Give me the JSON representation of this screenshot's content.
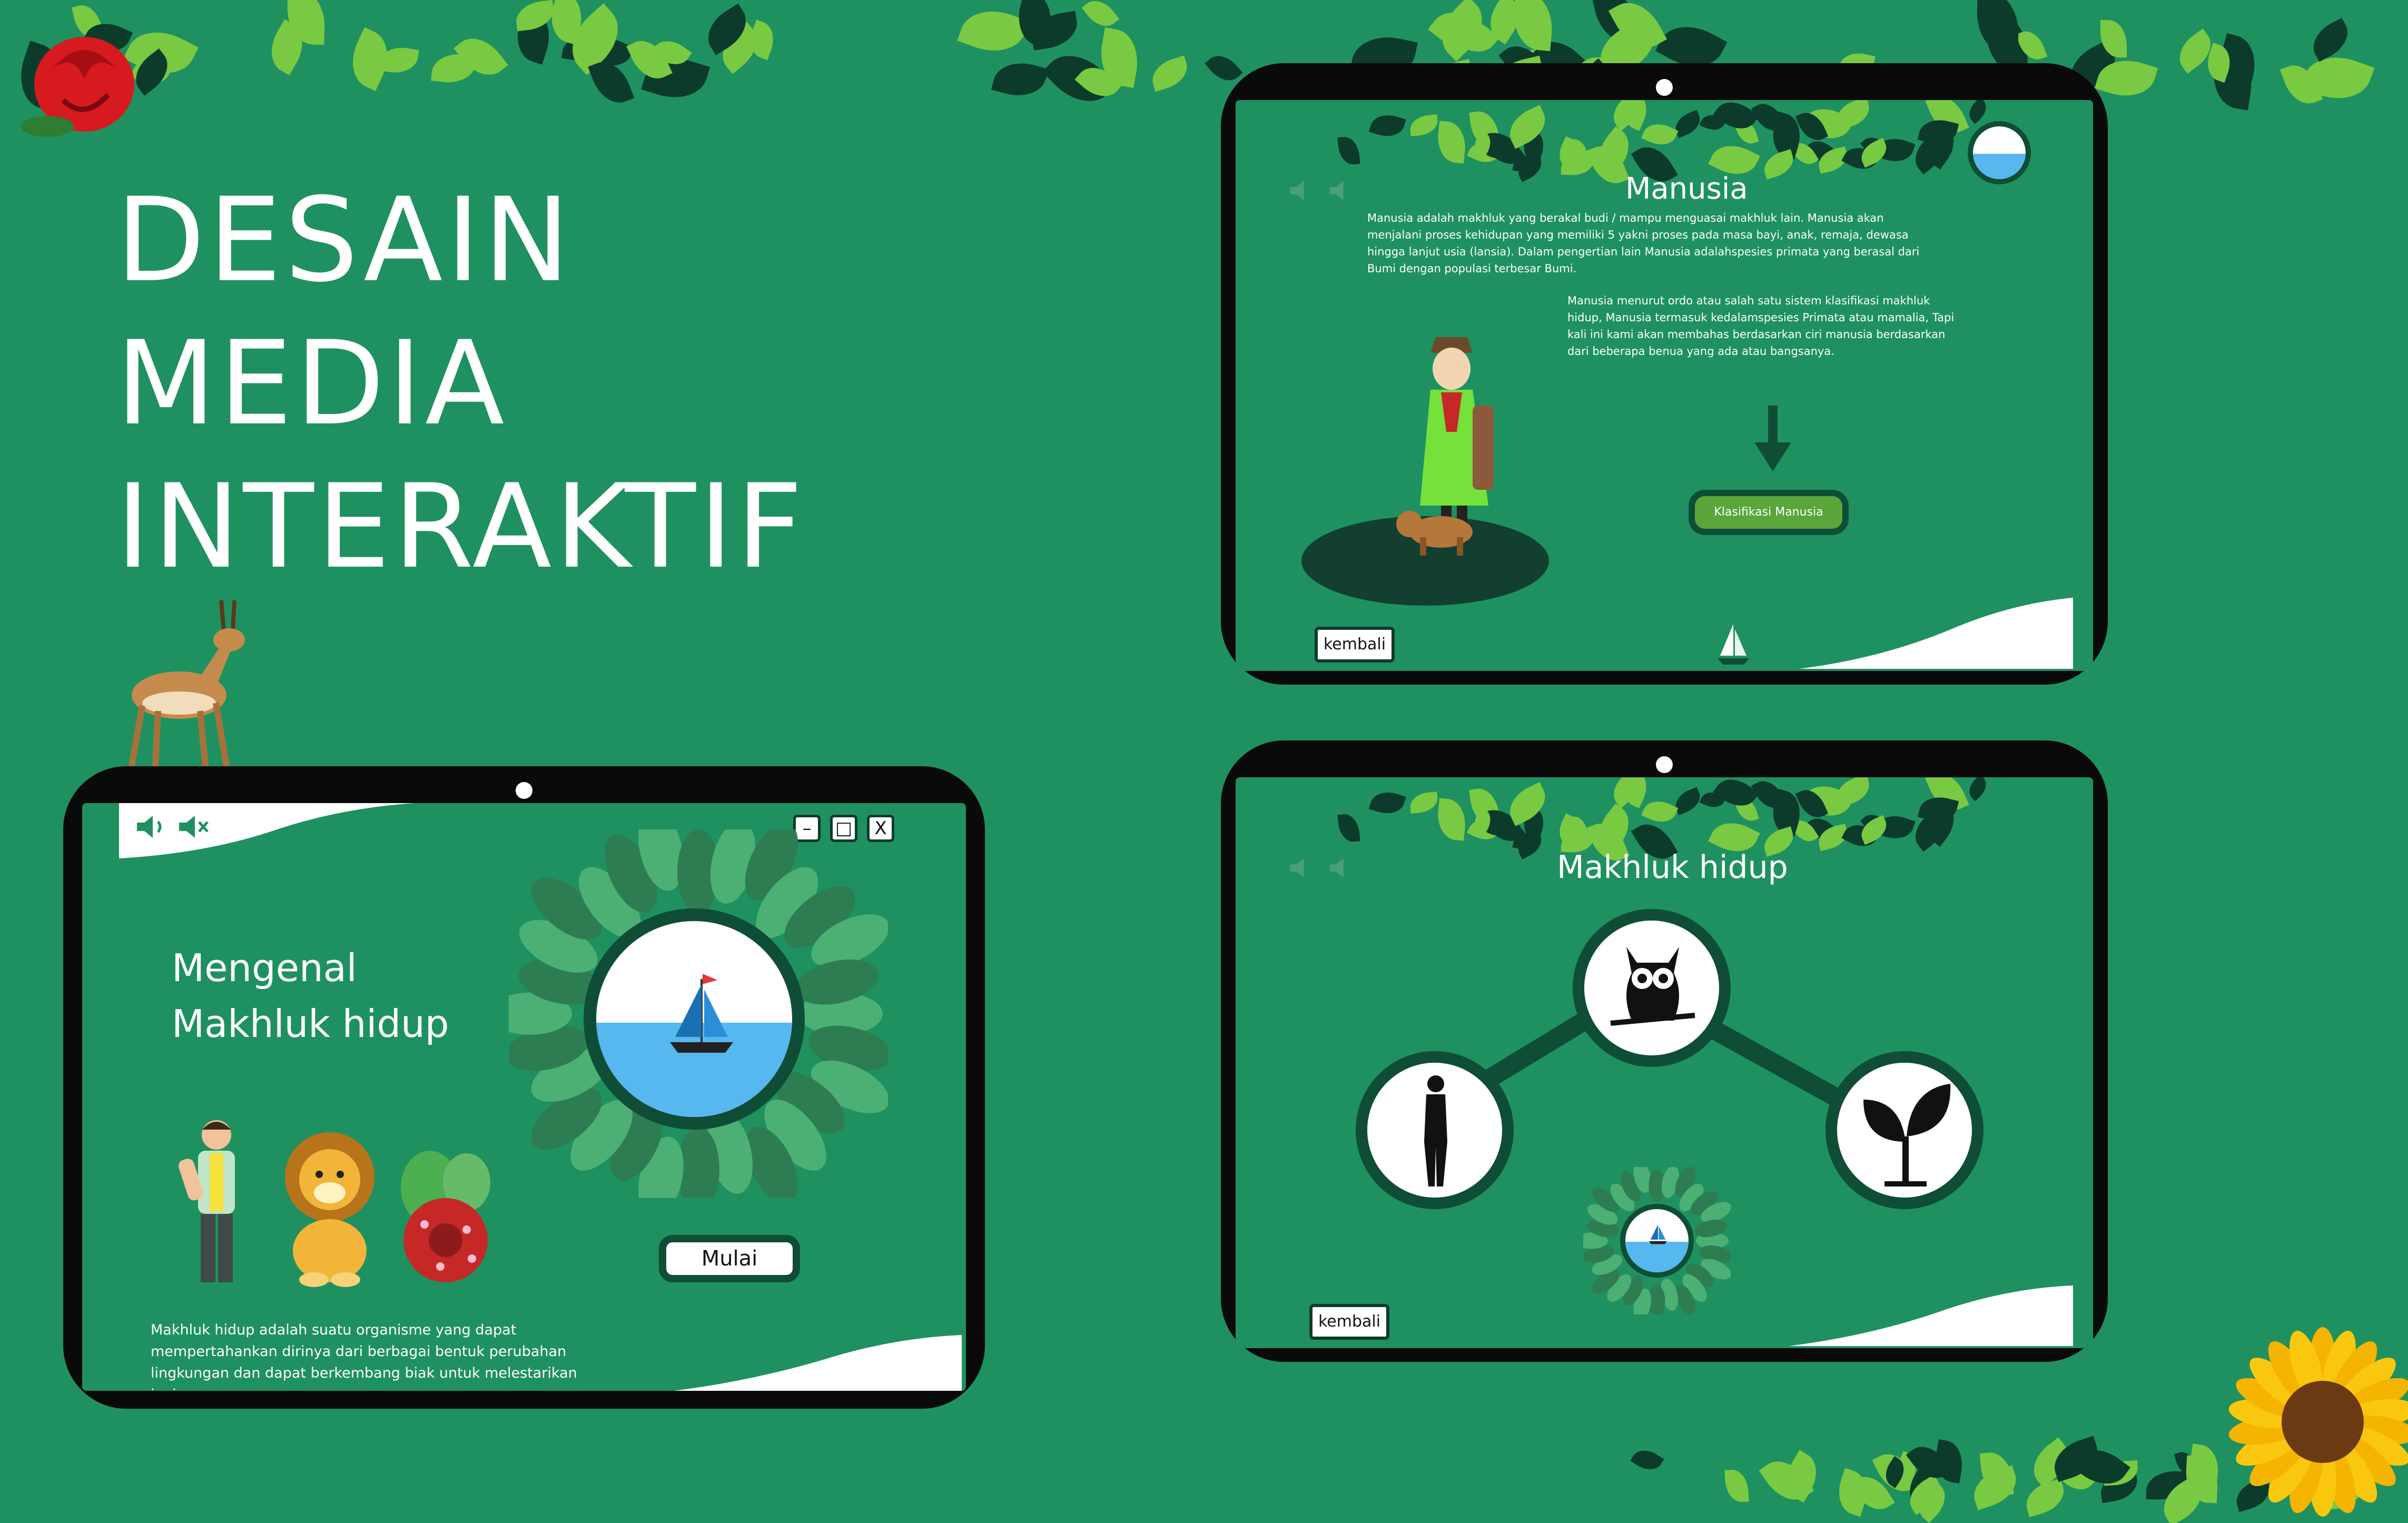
{
  "poster": {
    "title_lines": [
      "DESAIN",
      "MEDIA",
      "INTERAKTIF"
    ],
    "colors": {
      "background": "#1f9160",
      "dark": "#0f4d36",
      "white": "#ffffff",
      "sea": "#57b8f0",
      "leaf_light": "#7ac943",
      "leaf_dark": "#0d3b2b"
    }
  },
  "screen_home": {
    "heading_line1": "Mengenal",
    "heading_line2": "Makhluk hidup",
    "start_button": "Mulai",
    "description": "Makhluk hidup adalah suatu organisme yang dapat mempertahankan dirinya dari berbagai bentuk perubahan lingkungan dan dapat berkembang biak untuk melestarikan jenisnya.",
    "window_controls": {
      "minimize": "–",
      "maximize": "□",
      "close": "X"
    },
    "icons": [
      "speaker-on-icon",
      "speaker-mute-icon",
      "boat-logo-icon",
      "explorer-figure",
      "lion-figure",
      "rafflesia-figure"
    ]
  },
  "screen_manusia": {
    "title": "Manusia",
    "paragraph1": "Manusia adalah makhluk yang berakal budi / mampu menguasai makhluk lain. Manusia akan menjalani proses kehidupan yang memiliki 5 yakni proses pada masa bayi, anak, remaja, dewasa hingga lanjut usia (lansia). Dalam pengertian lain Manusia adalahspesies primata yang berasal dari Bumi dengan populasi terbesar Bumi.",
    "paragraph2": "Manusia menurut ordo atau salah satu sistem klasifikasi makhluk hidup, Manusia termasuk kedalamspesies Primata atau mamalia, Tapi kali ini kami akan membahas berdasarkan ciri manusia berdasarkan dari beberapa benua yang ada atau bangsanya.",
    "classify_button": "Klasifikasi Manusia",
    "back_button": "kembali"
  },
  "screen_makhluk": {
    "title": "Makhluk hidup",
    "back_button": "kembali",
    "nodes": [
      "owl-icon",
      "human-silhouette-icon",
      "sprout-icon"
    ]
  }
}
